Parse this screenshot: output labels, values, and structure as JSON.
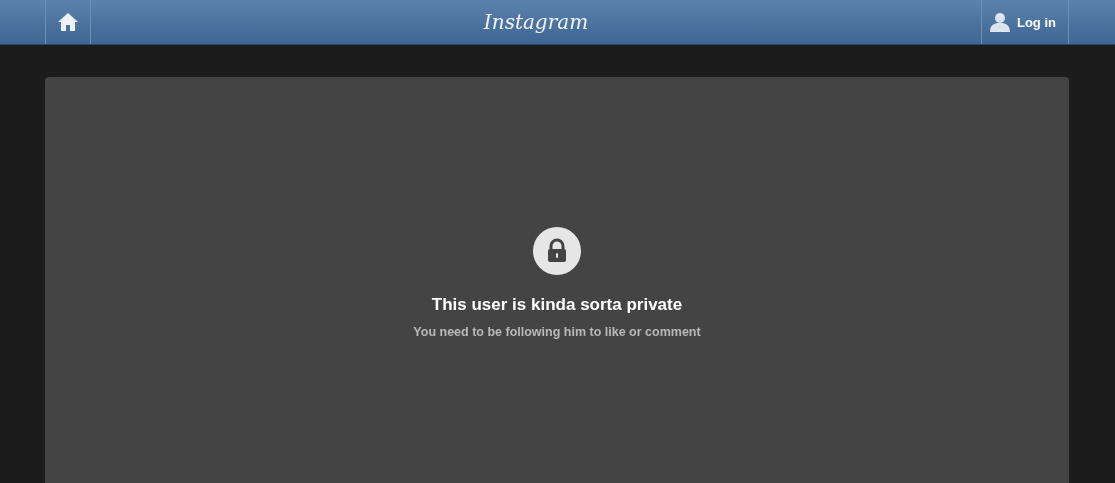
{
  "header": {
    "logo": "Instagram",
    "login": {
      "label": "Log in"
    }
  },
  "notice": {
    "title": "This user is kinda sorta private",
    "message": "You need to be following him to like or comment"
  }
}
